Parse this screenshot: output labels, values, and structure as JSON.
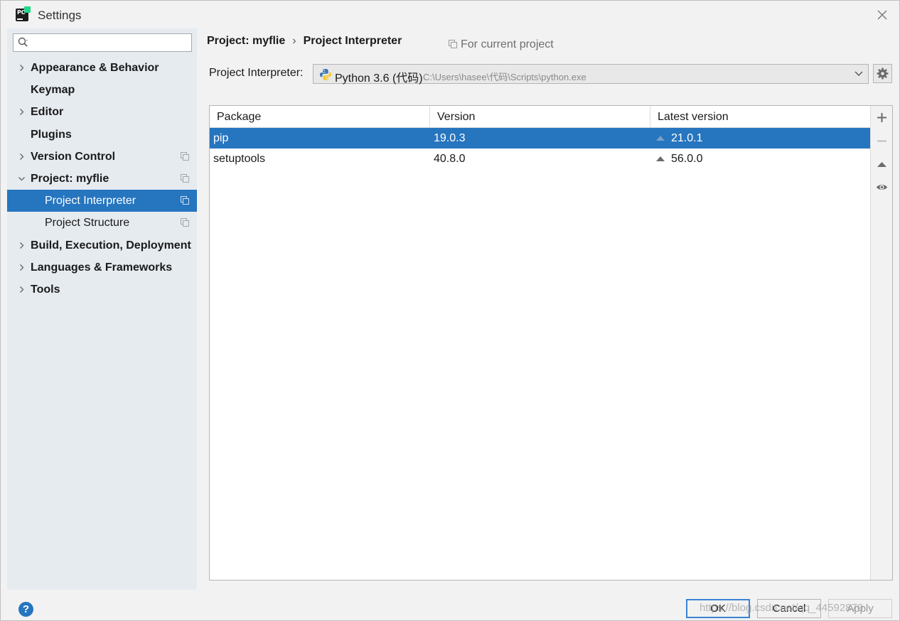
{
  "window": {
    "title": "Settings"
  },
  "sidebar": {
    "search": {
      "value": "",
      "placeholder": ""
    },
    "items": [
      {
        "label": "Appearance & Behavior",
        "expandable": true,
        "expanded": false,
        "bold": true,
        "child": false,
        "copy": false,
        "selected": false
      },
      {
        "label": "Keymap",
        "expandable": false,
        "expanded": false,
        "bold": true,
        "child": false,
        "copy": false,
        "selected": false
      },
      {
        "label": "Editor",
        "expandable": true,
        "expanded": false,
        "bold": true,
        "child": false,
        "copy": false,
        "selected": false
      },
      {
        "label": "Plugins",
        "expandable": false,
        "expanded": false,
        "bold": true,
        "child": false,
        "copy": false,
        "selected": false
      },
      {
        "label": "Version Control",
        "expandable": true,
        "expanded": false,
        "bold": true,
        "child": false,
        "copy": true,
        "selected": false
      },
      {
        "label": "Project: myflie",
        "expandable": true,
        "expanded": true,
        "bold": true,
        "child": false,
        "copy": true,
        "selected": false
      },
      {
        "label": "Project Interpreter",
        "expandable": false,
        "expanded": false,
        "bold": false,
        "child": true,
        "copy": true,
        "selected": true
      },
      {
        "label": "Project Structure",
        "expandable": false,
        "expanded": false,
        "bold": false,
        "child": true,
        "copy": true,
        "selected": false
      },
      {
        "label": "Build, Execution, Deployment",
        "expandable": true,
        "expanded": false,
        "bold": true,
        "child": false,
        "copy": false,
        "selected": false
      },
      {
        "label": "Languages & Frameworks",
        "expandable": true,
        "expanded": false,
        "bold": true,
        "child": false,
        "copy": false,
        "selected": false
      },
      {
        "label": "Tools",
        "expandable": true,
        "expanded": false,
        "bold": true,
        "child": false,
        "copy": false,
        "selected": false
      }
    ],
    "help_label": "?"
  },
  "main": {
    "breadcrumb": [
      "Project: myflie",
      "Project Interpreter"
    ],
    "breadcrumb_separator": "›",
    "scope_hint": "For current project",
    "interpreter": {
      "label": "Project Interpreter:",
      "name": "Python 3.6 (代码)",
      "path": "C:\\Users\\hasee\\代码\\Scripts\\python.exe"
    },
    "table": {
      "columns": [
        "Package",
        "Version",
        "Latest version"
      ],
      "rows": [
        {
          "package": "pip",
          "version": "19.0.3",
          "latest": "21.0.1",
          "selected": true
        },
        {
          "package": "setuptools",
          "version": "40.8.0",
          "latest": "56.0.0",
          "selected": false
        }
      ]
    },
    "tools": [
      "add-icon",
      "remove-icon",
      "upgrade-icon",
      "eye-icon"
    ]
  },
  "footer": {
    "ok_label": "OK",
    "cancel_label": "Cancel",
    "apply_label": "Apply",
    "watermark": "https://blog.csdn.net/qq_44592870"
  },
  "colors": {
    "selection": "#2675bf",
    "sidebar_bg": "#e6ebf0",
    "window_bg": "#f2f2f2",
    "focus_border": "#3a84d4"
  }
}
